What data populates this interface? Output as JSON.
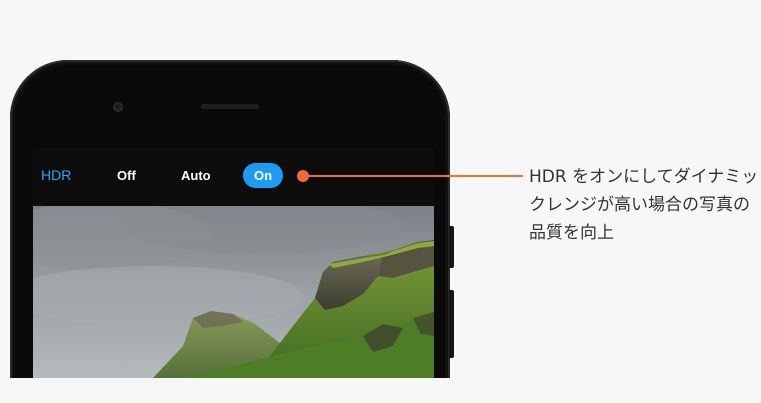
{
  "camera_toolbar": {
    "hdr_label": "HDR",
    "off_label": "Off",
    "auto_label": "Auto",
    "on_label": "On",
    "selected": "On"
  },
  "callout": {
    "text": "HDR をオンにしてダイナミックレンジが高い場合の写真の品質を向上"
  },
  "colors": {
    "accent_blue": "#1e9bf0",
    "hdr_label_blue": "#2ea3ff",
    "callout_orange": "#ee6b3b",
    "background": "#f7f7f7",
    "phone_body": "#0a0a0a"
  },
  "icons": {
    "front_camera": "camera-dot-icon",
    "earpiece": "speaker-grille-icon"
  }
}
